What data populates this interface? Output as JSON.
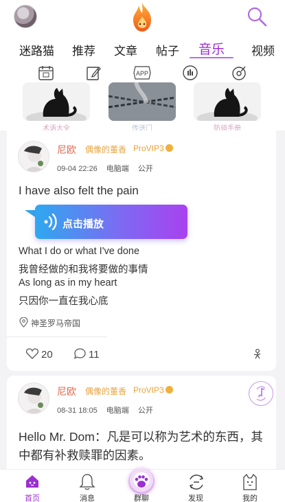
{
  "tabs": [
    {
      "label": "迷路猫"
    },
    {
      "label": "推荐"
    },
    {
      "label": "文章"
    },
    {
      "label": "帖子"
    },
    {
      "label": "音乐"
    },
    {
      "label": "视频"
    }
  ],
  "active_tab": "音乐",
  "subicons": [
    "calendar-icon",
    "edit-icon",
    "app-icon",
    "radio-icon",
    "music-disc-icon"
  ],
  "subicon_app_text": "APP",
  "banners": [
    {
      "label": "术语大全",
      "icon": "black-cat-image"
    },
    {
      "label": "传送门",
      "icon": "chains-image"
    },
    {
      "label": "防骑手册",
      "icon": "black-cat-image"
    }
  ],
  "posts": [
    {
      "user": "尼欧",
      "title": "偶像的董香",
      "vip": "ProVIP3",
      "date": "09-04 22:26",
      "device": "电脑端",
      "visibility": "公开",
      "headline": "I have also felt the pain",
      "play_label": "点击播放",
      "lyrics": [
        "What I do or what I've done",
        "我曾经做的和我将要做的事情",
        "As long as in my heart",
        "只因你一直在我心底"
      ],
      "location": "神圣罗马帝国",
      "likes": "20",
      "comments": "11"
    },
    {
      "user": "尼欧",
      "title": "偶像的董香",
      "vip": "ProVIP3",
      "date": "08-31 18:05",
      "device": "电脑端",
      "visibility": "公开",
      "text": "Hello Mr. Dom：凡是可以称为艺术的东西，其中都有补救赎罪的因素。"
    }
  ],
  "bottom_nav": [
    {
      "label": "首页",
      "icon": "home-icon",
      "active": true
    },
    {
      "label": "消息",
      "icon": "bell-icon",
      "active": false
    },
    {
      "label": "群聊",
      "icon": "paw-icon",
      "active": false
    },
    {
      "label": "发现",
      "icon": "discover-icon",
      "active": false
    },
    {
      "label": "我的",
      "icon": "cat-face-icon",
      "active": false
    }
  ],
  "colors": {
    "accent": "#9b2fd1",
    "username": "#e06a4f",
    "title": "#e8a23c",
    "play_gradient_start": "#2ea8f0",
    "play_gradient_end": "#a941f0"
  }
}
